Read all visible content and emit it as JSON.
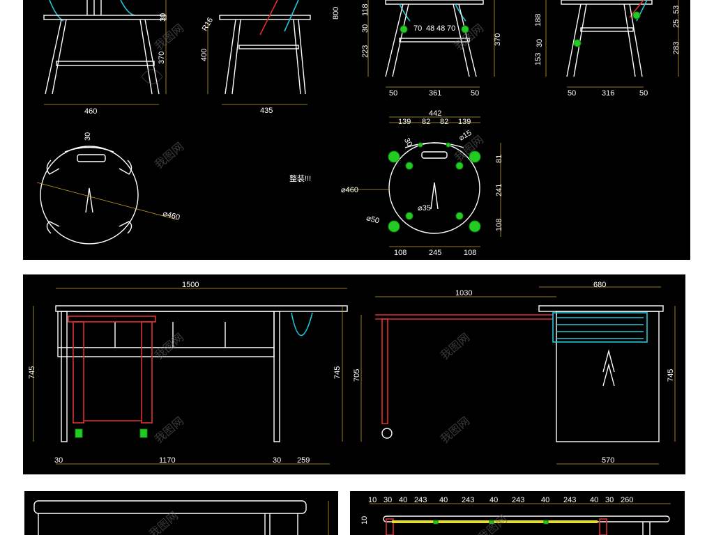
{
  "panel_top": {
    "chair_front": {
      "width": "460",
      "height_a": "30",
      "height_b": "370"
    },
    "chair_side": {
      "height": "400",
      "radius": "R16",
      "width": "435",
      "total": "800"
    },
    "chair_front2": {
      "dims_left": [
        "118",
        "30",
        "223"
      ],
      "dims_mid": [
        "70",
        "48",
        "48",
        "70"
      ],
      "height": "370",
      "bottom": [
        "50",
        "361",
        "50"
      ]
    },
    "chair_side2": {
      "dims_left": [
        "188",
        "30",
        "153"
      ],
      "dims_right": [
        "53",
        "25",
        "283"
      ],
      "bottom": [
        "50",
        "316",
        "50"
      ]
    },
    "seat_top_left": {
      "d1": "30",
      "d2": "⌀460"
    },
    "note": "整装!!!",
    "seat_plan": {
      "top": [
        "139",
        "82",
        "82",
        "139"
      ],
      "overall": "442",
      "d15": "⌀15",
      "d30": "30",
      "right": [
        "81",
        "241",
        "108"
      ],
      "d460": "⌀460",
      "d35": "⌀35",
      "d50": "⌀50",
      "bottom": [
        "108",
        "245",
        "108"
      ]
    }
  },
  "panel_mid": {
    "desk_front": {
      "width": "1500",
      "height_l": "745",
      "height_r": "745",
      "bottom": [
        "30",
        "1170",
        "30",
        "259"
      ]
    },
    "desk_side": {
      "width_a": "1030",
      "width_b": "680",
      "height_l": "705",
      "height_r": "745",
      "bottom": "570"
    }
  },
  "panel_bottom_right": {
    "dims": [
      "10",
      "30",
      "40",
      "243",
      "40",
      "243",
      "40",
      "243",
      "40",
      "243",
      "40",
      "30",
      "260"
    ],
    "left": "10"
  },
  "watermark": "我图网"
}
